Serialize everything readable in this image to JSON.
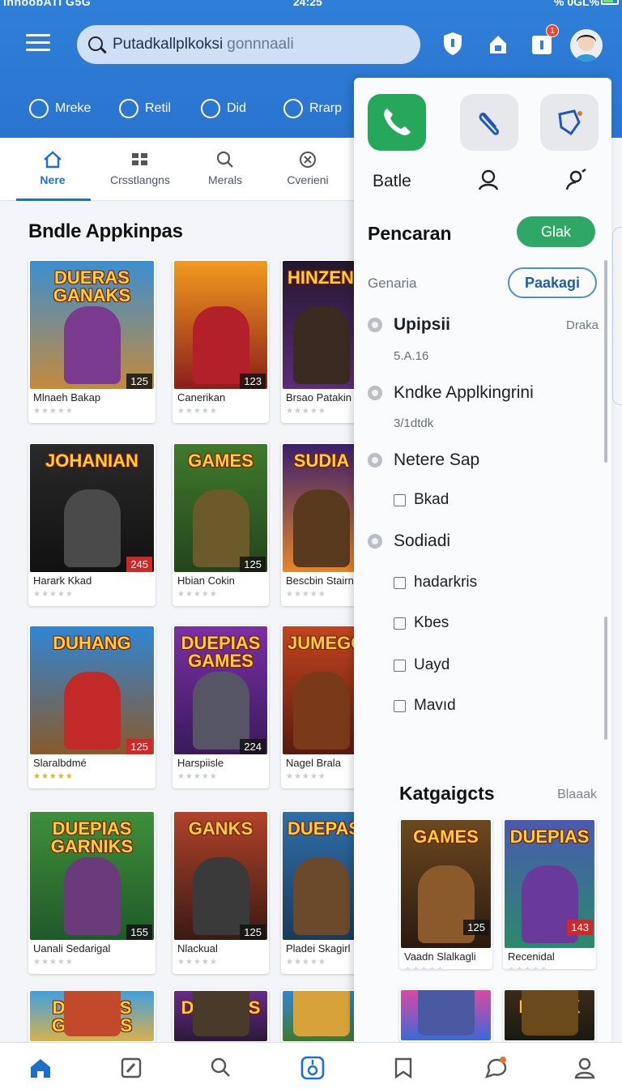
{
  "status_bar": {
    "left": "InnoobATI G5G",
    "time": "24:25",
    "right": "% 0GL%"
  },
  "search": {
    "query": "Putadkallplkoksi",
    "query_dim": "gonnnaali"
  },
  "header": {
    "notification_count": "1"
  },
  "quick_actions": [
    {
      "label": "Mreke",
      "icon": "headset-icon"
    },
    {
      "label": "Retil",
      "icon": "check-circle-icon"
    },
    {
      "label": "Did",
      "icon": "search-icon"
    },
    {
      "label": "Rrarp",
      "icon": "compass-icon"
    }
  ],
  "tabs": [
    {
      "label": "Nere",
      "icon": "home-icon",
      "active": true
    },
    {
      "label": "Crsstlangns",
      "icon": "grid-icon",
      "active": false
    },
    {
      "label": "Merals",
      "icon": "search-icon",
      "active": false
    },
    {
      "label": "Cverieni",
      "icon": "close-circle-icon",
      "active": false
    }
  ],
  "main": {
    "title": "Bndle Appkinpas",
    "cards": [
      {
        "name": "Mlnaeh Bakap",
        "logo": "DUERAS GANAKS",
        "num": "125",
        "num_red": false,
        "stars": "★★★★★",
        "gold": false,
        "bg": "#3a8fd1",
        "bg2": "#c58a3b",
        "hero": "#7a3b8f"
      },
      {
        "name": "Canerikan",
        "logo": "",
        "num": "123",
        "num_red": false,
        "stars": "★★★★★",
        "gold": false,
        "bg": "#f29a1f",
        "bg2": "#8b1e1a",
        "hero": "#b4202a"
      },
      {
        "name": "Brsao Patakin",
        "logo": "HINZENI",
        "num": "",
        "num_red": false,
        "stars": "★★★★★",
        "gold": false,
        "bg": "#22182e",
        "bg2": "#5c2c7a",
        "hero": "#3a2a1f"
      },
      {
        "name": "Harark Kkad",
        "logo": "JOHANIAN",
        "num": "245",
        "num_red": true,
        "stars": "★★★★★",
        "gold": false,
        "bg": "#2a2a2a",
        "bg2": "#111111",
        "hero": "#4a4a4a"
      },
      {
        "name": "Hbian Cokin",
        "logo": "GAMES",
        "num": "125",
        "num_red": false,
        "stars": "★★★★★",
        "gold": false,
        "bg": "#3f7a2c",
        "bg2": "#24451a",
        "hero": "#6b5a2a"
      },
      {
        "name": "Bescbin Stairn",
        "logo": "SUDIA",
        "num": "",
        "num_red": false,
        "stars": "★★★★★",
        "gold": false,
        "bg": "#3a1f6e",
        "bg2": "#e6862a",
        "hero": "#5a3a1f"
      },
      {
        "name": "Slaralbdmé",
        "logo": "DUHANG",
        "num": "125",
        "num_red": true,
        "stars": "★★★★★",
        "gold": true,
        "bg": "#2f86d6",
        "bg2": "#8a5a2a",
        "hero": "#c22a2a"
      },
      {
        "name": "Harspiisle",
        "logo": "DUEPIAS GAMES",
        "num": "224",
        "num_red": false,
        "stars": "★★★★★",
        "gold": false,
        "bg": "#7a2fa6",
        "bg2": "#3a1a5a",
        "hero": "#555566"
      },
      {
        "name": "Nagel Brala",
        "logo": "JUMEGGR",
        "num": "",
        "num_red": false,
        "stars": "★★★★★",
        "gold": false,
        "bg": "#c2441f",
        "bg2": "#5a1a0f",
        "hero": "#7a3a1a"
      },
      {
        "name": "Uanali Sedarigal",
        "logo": "DUEPIAS GARNIKS",
        "num": "155",
        "num_red": false,
        "stars": "★★★★★",
        "gold": false,
        "bg": "#3f8f3a",
        "bg2": "#1f5a2a",
        "hero": "#6a3a7a"
      },
      {
        "name": "Nlackual",
        "logo": "GANKS",
        "num": "125",
        "num_red": false,
        "stars": "★★★★★",
        "gold": false,
        "bg": "#b2432a",
        "bg2": "#3a1a12",
        "hero": "#3a3a3a"
      },
      {
        "name": "Pladei Skagirl",
        "logo": "DUEPAS",
        "num": "",
        "num_red": false,
        "stars": "★★★★★",
        "gold": false,
        "bg": "#2f6faa",
        "bg2": "#1a3a5a",
        "hero": "#6a4a2a"
      },
      {
        "name": "",
        "logo": "DUEPIAS GAMAGS",
        "num": "",
        "num_red": false,
        "stars": "",
        "gold": false,
        "bg": "#3fa0e0",
        "bg2": "#d8b24a",
        "hero": "#c24a2a"
      },
      {
        "name": "",
        "logo": "DUEPIAS",
        "num": "",
        "num_red": false,
        "stars": "",
        "gold": false,
        "bg": "#6a2a8a",
        "bg2": "#2a1a3a",
        "hero": "#4a3a2a"
      },
      {
        "name": "",
        "logo": "",
        "num": "",
        "num_red": false,
        "stars": "",
        "gold": false,
        "bg": "#2f86d6",
        "bg2": "#3f7a2c",
        "hero": "#d8a23a"
      }
    ]
  },
  "panel": {
    "apps": [
      {
        "label": "Batle",
        "icon": "phone-icon"
      },
      {
        "label": "",
        "icon": "paperclip-icon"
      },
      {
        "label": "",
        "icon": "edit-shield-icon"
      }
    ],
    "title": "Pencaran",
    "title_button": "Glak",
    "subtitle": "Genaria",
    "outline_button": "Paakagi",
    "filters": [
      {
        "type": "radio",
        "label": "Upipsii",
        "bold": true,
        "right": "Draka"
      },
      {
        "type": "sub",
        "label": "5.A.16"
      },
      {
        "type": "radio",
        "label": "Kndke Applkingrini",
        "bold": false
      },
      {
        "type": "sub",
        "label": "3/1dtdk"
      },
      {
        "type": "radio",
        "label": "Netere Sap",
        "bold": false
      },
      {
        "type": "check",
        "label": "Bkad"
      },
      {
        "type": "radio",
        "label": "Sodiadi",
        "bold": false
      },
      {
        "type": "check",
        "label": "hadarkris"
      },
      {
        "type": "check",
        "label": "Kbes"
      },
      {
        "type": "check",
        "label": "Uayd"
      },
      {
        "type": "check",
        "label": "Mavıd"
      }
    ],
    "kat_title": "Katgaigcts",
    "kat_more": "Blaaak",
    "kat_cards": [
      {
        "name": "Vaadn Slalkagli",
        "logo": "GAMES",
        "num": "125",
        "num_red": false,
        "stars": "★★★★★",
        "gold": false,
        "bg": "#6a4a1f",
        "bg2": "#2a1a0f",
        "hero": "#8a5a2a"
      },
      {
        "name": "Recenidal",
        "logo": "DUEPIAS",
        "num": "143",
        "num_red": true,
        "stars": "★★★★★",
        "gold": false,
        "bg": "#4a5ab2",
        "bg2": "#2a8a6a",
        "hero": "#6a3a9a"
      },
      {
        "name": "",
        "logo": "",
        "num": "",
        "num_red": false,
        "stars": "",
        "gold": false,
        "bg": "#d84aa2",
        "bg2": "#3a6ad6",
        "hero": "#4a5aa2"
      },
      {
        "name": "",
        "logo": "DIADIK",
        "num": "",
        "num_red": false,
        "stars": "",
        "gold": false,
        "bg": "#3a2a1a",
        "bg2": "#1a1a12",
        "hero": "#6a4a1a"
      }
    ]
  },
  "bottom_nav": [
    {
      "icon": "home-icon",
      "active": true
    },
    {
      "icon": "edit-icon",
      "active": false
    },
    {
      "icon": "search-icon",
      "active": false
    },
    {
      "icon": "app-icon",
      "active": false
    },
    {
      "icon": "bookmark-icon",
      "active": false
    },
    {
      "icon": "chat-icon",
      "active": false
    },
    {
      "icon": "profile-icon",
      "active": false
    }
  ],
  "colors": {
    "header": "#2f7fd8",
    "accent": "#1b6fcf",
    "green": "#2fa865",
    "badge": "#e8482f"
  }
}
